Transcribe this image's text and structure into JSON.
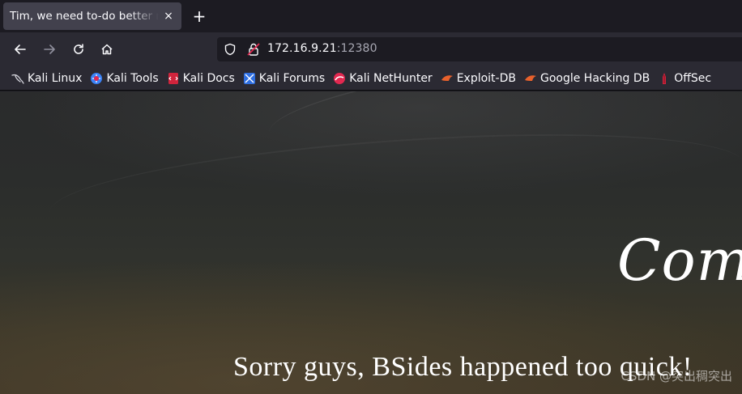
{
  "tab": {
    "title": "Tim, we need to-do better next year for Initech"
  },
  "toolbar": {
    "new_tab_label": "+",
    "close_label": "×"
  },
  "url": {
    "host": "172.16.9.21",
    "port": ":12380"
  },
  "bookmarks": [
    {
      "label": "Kali Linux",
      "icon": "kali-dragon-icon"
    },
    {
      "label": "Kali Tools",
      "icon": "kali-tools-icon"
    },
    {
      "label": "Kali Docs",
      "icon": "kali-docs-icon"
    },
    {
      "label": "Kali Forums",
      "icon": "kali-forums-icon"
    },
    {
      "label": "Kali NetHunter",
      "icon": "nethunter-icon"
    },
    {
      "label": "Exploit-DB",
      "icon": "exploit-db-icon"
    },
    {
      "label": "Google Hacking DB",
      "icon": "ghdb-icon"
    },
    {
      "label": "OffSec",
      "icon": "offsec-icon"
    }
  ],
  "page": {
    "headline": "Comi",
    "subline": "Sorry guys, BSides happened too quick!",
    "watermark": "CSDN @突出稠突出"
  },
  "colors": {
    "accent_red": "#e22850",
    "kali_blue": "#3b82f6"
  }
}
